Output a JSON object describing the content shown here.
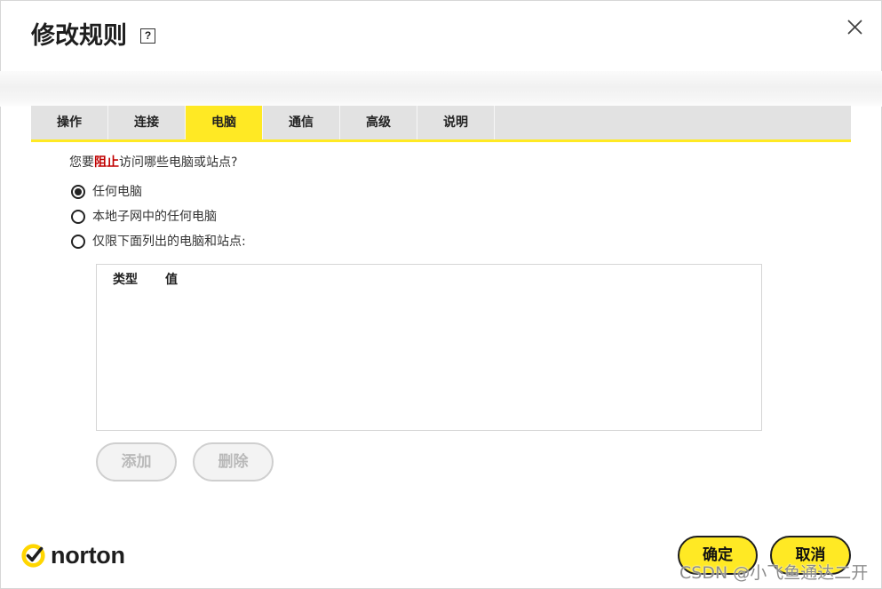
{
  "dialog": {
    "title": "修改规则",
    "help_glyph": "?",
    "help_icon": "help-icon",
    "close_icon": "close-icon"
  },
  "tabs": [
    {
      "label": "操作",
      "active": false
    },
    {
      "label": "连接",
      "active": false
    },
    {
      "label": "电脑",
      "active": true
    },
    {
      "label": "通信",
      "active": false
    },
    {
      "label": "高级",
      "active": false
    },
    {
      "label": "说明",
      "active": false
    }
  ],
  "question": {
    "prefix": "您要",
    "emphasis": "阻止",
    "suffix": "访问哪些电脑或站点?"
  },
  "options": [
    {
      "label": "任何电脑",
      "checked": true
    },
    {
      "label": "本地子网中的任何电脑",
      "checked": false
    },
    {
      "label": "仅限下面列出的电脑和站点:",
      "checked": false
    }
  ],
  "list": {
    "columns": [
      "类型",
      "值"
    ]
  },
  "list_buttons": {
    "add_label": "添加",
    "add_disabled": true,
    "delete_label": "删除",
    "delete_disabled": true
  },
  "brand": {
    "logo_icon": "norton-check-icon",
    "name": "norton"
  },
  "footer": {
    "ok_label": "确定",
    "cancel_label": "取消"
  },
  "watermark": "CSDN @小飞鱼通达二开",
  "colors": {
    "accent": "#ffe924",
    "emphasis": "#c00000",
    "text": "#333333",
    "tab_bg": "#e2e2e2",
    "disabled_text": "#b9b9b9"
  }
}
